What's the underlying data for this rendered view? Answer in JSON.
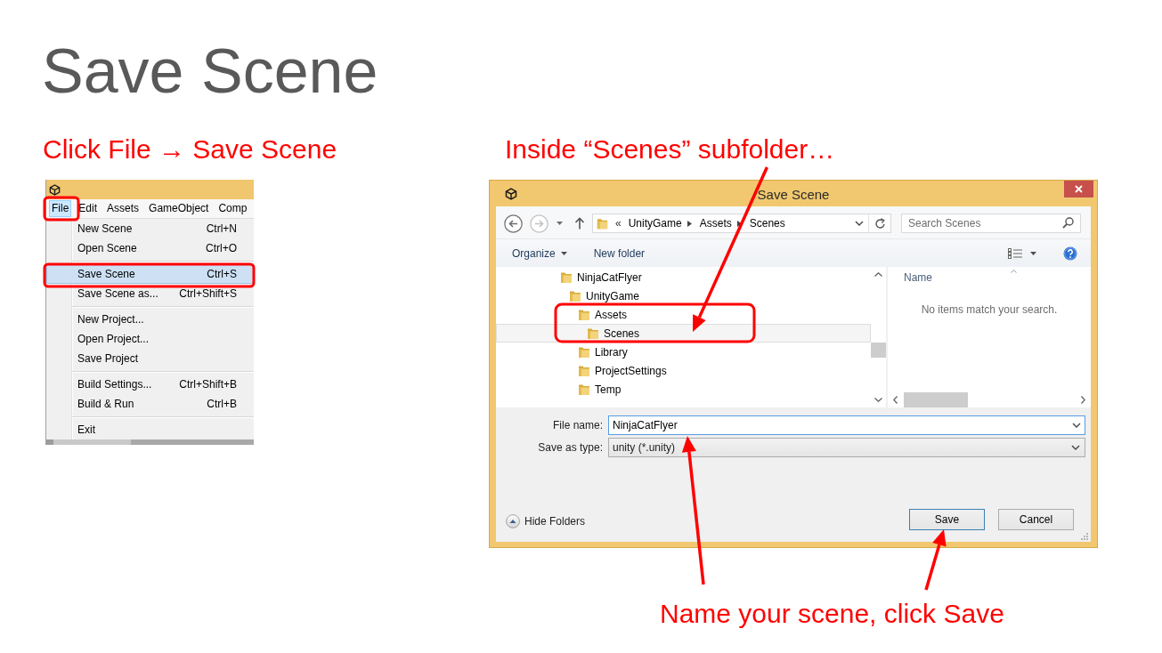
{
  "slide": {
    "title": "Save Scene"
  },
  "left": {
    "caption": "Click File → Save Scene",
    "menu_bar": [
      {
        "label": "File",
        "selected": true
      },
      {
        "label": "Edit",
        "selected": false
      },
      {
        "label": "Assets",
        "selected": false
      },
      {
        "label": "GameObject",
        "selected": false
      },
      {
        "label": "Comp",
        "selected": false
      }
    ],
    "menu": [
      {
        "kind": "item",
        "label": "New Scene",
        "shortcut": "Ctrl+N",
        "selected": false
      },
      {
        "kind": "item",
        "label": "Open Scene",
        "shortcut": "Ctrl+O",
        "selected": false
      },
      {
        "kind": "separator"
      },
      {
        "kind": "item",
        "label": "Save Scene",
        "shortcut": "Ctrl+S",
        "selected": true
      },
      {
        "kind": "item",
        "label": "Save Scene as...",
        "shortcut": "Ctrl+Shift+S",
        "selected": false
      },
      {
        "kind": "separator"
      },
      {
        "kind": "item",
        "label": "New Project...",
        "selected": false
      },
      {
        "kind": "item",
        "label": "Open Project...",
        "selected": false
      },
      {
        "kind": "item",
        "label": "Save Project",
        "selected": false
      },
      {
        "kind": "separator"
      },
      {
        "kind": "item",
        "label": "Build Settings...",
        "shortcut": "Ctrl+Shift+B",
        "selected": false
      },
      {
        "kind": "item",
        "label": "Build & Run",
        "shortcut": "Ctrl+B",
        "selected": false
      },
      {
        "kind": "separator"
      },
      {
        "kind": "item",
        "label": "Exit",
        "selected": false
      }
    ]
  },
  "right": {
    "caption": "Inside “Scenes” subfolder…",
    "dialog": {
      "title": "Save Scene",
      "nav": {
        "back": {
          "disabled": false
        },
        "forward": {
          "disabled": true
        }
      },
      "address": {
        "overflow": "«",
        "path": [
          "UnityGame",
          "Assets",
          "Scenes"
        ]
      },
      "search": {
        "placeholder": "Search Scenes"
      },
      "toolbar": [
        {
          "kind": "menu",
          "label": "Organize"
        },
        {
          "kind": "button",
          "label": "New folder"
        }
      ],
      "tree": [
        {
          "label": "NinjaCatFlyer",
          "selected": false,
          "children": [
            {
              "label": "UnityGame",
              "selected": false,
              "children": [
                {
                  "label": "Assets",
                  "selected": false,
                  "children": [
                    {
                      "label": "Scenes",
                      "selected": true
                    }
                  ]
                },
                {
                  "label": "Library",
                  "selected": false
                },
                {
                  "label": "ProjectSettings",
                  "selected": false
                },
                {
                  "label": "Temp",
                  "selected": false
                }
              ]
            }
          ]
        }
      ],
      "list": {
        "column": "Name",
        "empty_message": "No items match your search."
      },
      "file_name": {
        "label": "File name:",
        "value": "NinjaCatFlyer"
      },
      "save_as_type": {
        "label": "Save as type:",
        "value": "unity (*.unity)"
      },
      "hide_folders": "Hide Folders",
      "buttons": [
        {
          "label": "Save",
          "default": true
        },
        {
          "label": "Cancel",
          "default": false
        }
      ]
    }
  },
  "footer_caption": "Name your scene, click Save"
}
